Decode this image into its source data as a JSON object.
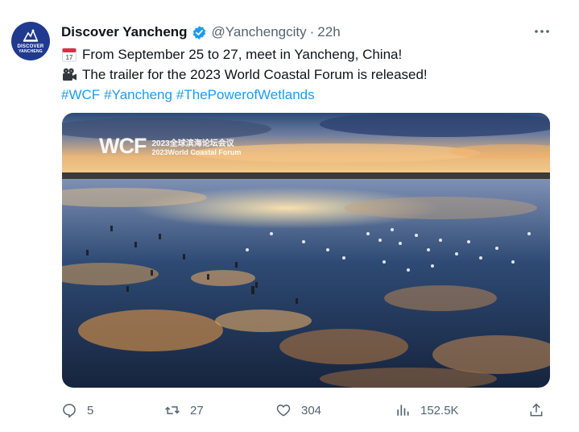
{
  "account": {
    "avatar_line1": "DISCOVER",
    "avatar_line2": "YANCHENG",
    "name": "Discover Yancheng",
    "handle": "@Yanchengcity",
    "separator": "·",
    "time": "22h",
    "verified": true
  },
  "post": {
    "line1_emoji": "calendar-icon",
    "line1_emoji_text": "17",
    "line1": "From September 25 to 27, meet in Yancheng, China!",
    "line2_emoji": "movie-camera-icon",
    "line2": "The trailer for the 2023 World Coastal Forum is released!",
    "hashtags": [
      "#WCF",
      "#Yancheng",
      "#ThePowerofWetlands"
    ]
  },
  "media": {
    "watermark_logo": "WCF",
    "watermark_cn": "2023全球滨海论坛会议",
    "watermark_en": "2023World Coastal Forum",
    "description_icon": "wetland-birds-sunset-image"
  },
  "actions": {
    "replies": "5",
    "reposts": "27",
    "likes": "304",
    "views": "152.5K"
  },
  "colors": {
    "accent": "#1d9bf0",
    "muted": "#536471",
    "verified": "#1d9bf0"
  }
}
